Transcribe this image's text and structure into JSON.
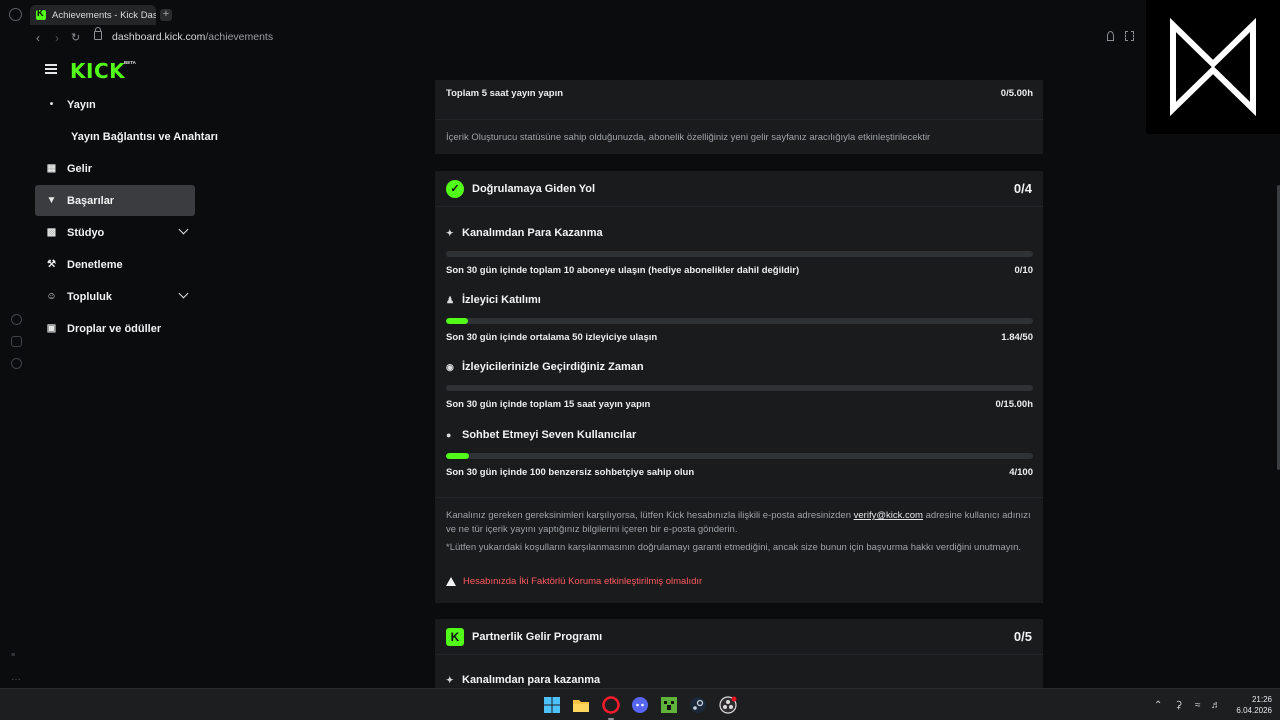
{
  "browser": {
    "tab_title": "Achievements - Kick Dashboard",
    "url_domain": "dashboard.kick.com",
    "url_path": "/achievements"
  },
  "sidebar": {
    "logo": "KICK",
    "beta": "BETA",
    "items": [
      {
        "label": "Yayın",
        "icon": "broadcast-icon"
      },
      {
        "label": "Yayın Bağlantısı ve Anahtarı",
        "icon": "none"
      },
      {
        "label": "Gelir",
        "icon": "chart-icon"
      },
      {
        "label": "Başarılar",
        "icon": "trophy-icon",
        "active": true
      },
      {
        "label": "Stüdyo",
        "icon": "studio-icon",
        "expandable": true
      },
      {
        "label": "Denetleme",
        "icon": "wrench-icon"
      },
      {
        "label": "Topluluk",
        "icon": "community-icon",
        "expandable": true
      },
      {
        "label": "Droplar ve ödüller",
        "icon": "gift-icon"
      }
    ]
  },
  "top_card": {
    "requirement": "Toplam 5 saat yayın yapın",
    "value": "0/5.00h",
    "note": "İçerik Oluşturucu statüsüne sahip olduğunuzda, abonelik özelliğiniz yeni gelir sayfanız aracılığıyla etkinleştirilecektir"
  },
  "verification_card": {
    "title": "Doğrulamaya Giden Yol",
    "count": "0/4",
    "achievements": [
      {
        "name": "Kanalımdan Para Kazanma",
        "icon": "sparkle-icon",
        "requirement": "Son 30 gün içinde toplam 10 aboneye ulaşın (hediye abonelikler dahil değildir)",
        "value": "0/10",
        "progress": 0
      },
      {
        "name": "İzleyici Katılımı",
        "icon": "viewers-icon",
        "requirement": "Son 30 gün içinde ortalama 50 izleyiciye ulaşın",
        "value": "1.84/50",
        "progress": 0.037
      },
      {
        "name": "İzleyicilerinizle Geçirdiğiniz Zaman",
        "icon": "broadcast-icon",
        "requirement": "Son 30 gün içinde toplam 15 saat yayın yapın",
        "value": "0/15.00h",
        "progress": 0
      },
      {
        "name": "Sohbet Etmeyi Seven Kullanıcılar",
        "icon": "chat-icon",
        "requirement": "Son 30 gün içinde 100 benzersiz sohbetçiye sahip olun",
        "value": "4/100",
        "progress": 0.04
      }
    ],
    "note_before_link": "Kanalınız gereken gereksinimleri karşılıyorsa, lütfen Kick hesabınızla ilişkili e-posta adresinizden",
    "note_link": "verify@kick.com",
    "note_after_link": "adresine kullanıcı adınızı ve ne tür içerik yayını yaptığınız bilgilerini içeren bir e-posta gönderin.",
    "disclaimer": "*Lütfen yukarıdaki koşulların karşılanmasının doğrulamayı garanti etmediğini, ancak size bunun için başvurma hakkı verdiğini unutmayın.",
    "warning": "Hesabınızda İki Faktörlü Koruma etkinleştirilmiş olmalıdır"
  },
  "partner_card": {
    "title": "Partnerlik Gelir Programı",
    "count": "0/5",
    "first_achievement": "Kanalımdan para kazanma"
  },
  "taskbar": {
    "time": "21:26",
    "date": "6.04.2026"
  },
  "colors": {
    "accent": "#53fc18",
    "warning": "#ff5a5f",
    "card": "#191b1d",
    "background": "#0b0c0d"
  }
}
